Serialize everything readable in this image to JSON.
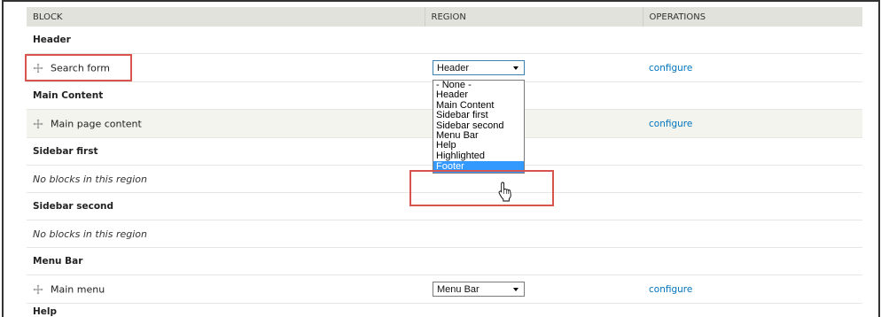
{
  "table": {
    "headers": {
      "block": "BLOCK",
      "region": "REGION",
      "operations": "OPERATIONS"
    }
  },
  "regions": {
    "header": {
      "title": "Header",
      "block_label": "Search form",
      "select_value": "Header",
      "configure": "configure"
    },
    "main_content": {
      "title": "Main Content",
      "block_label": "Main page content",
      "configure": "configure"
    },
    "sidebar_first": {
      "title": "Sidebar first",
      "empty_text": "No blocks in this region"
    },
    "sidebar_second": {
      "title": "Sidebar second",
      "empty_text": "No blocks in this region"
    },
    "menu_bar": {
      "title": "Menu Bar",
      "block_label": "Main menu",
      "select_value": "Menu Bar",
      "configure": "configure"
    },
    "help": {
      "title": "Help"
    }
  },
  "dropdown": {
    "options": [
      "- None -",
      "Header",
      "Main Content",
      "Sidebar first",
      "Sidebar second",
      "Menu Bar",
      "Help",
      "Highlighted",
      "Footer"
    ],
    "highlighted_option": "Footer"
  },
  "colors": {
    "header_bg": "#e1e2dc",
    "link": "#0074bd",
    "annotation": "#d9534f",
    "selected_option_bg": "#3399ff"
  },
  "icons": {
    "drag": "drag-handle-icon",
    "cursor": "mouse-pointer-icon",
    "select_arrow": "chevron-down-icon"
  }
}
